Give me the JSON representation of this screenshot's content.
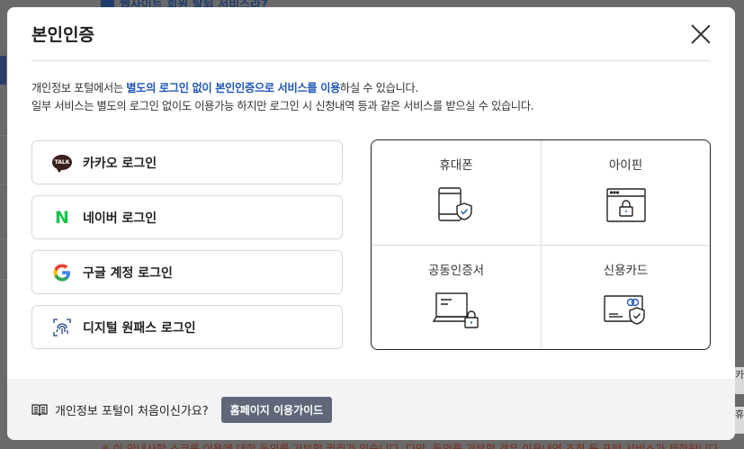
{
  "background": {
    "top_link": "웹사이트 회원 탈퇴 서비스라?",
    "bottom_notice": "※ 이 안내사항 스크롤 이용에 대한 동의를 거부할 권리가 있습니다. 다만, 동의를 거부할 경우 이용내역 조회 등 포털 서비스가 제한됩니다.",
    "right_chip_1": "카",
    "right_chip_2": "휴"
  },
  "modal": {
    "title": "본인인증",
    "intro": {
      "line1_prefix": "개인정보 포털에서는 ",
      "line1_emphasis": "별도의 로그인 없이 본인인증으로 서비스를 이용",
      "line1_suffix": "하실 수 있습니다.",
      "line2": "일부 서비스는 별도의 로그인 없이도 이용가능 하지만 로그인 시 신청내역 등과 같은 서비스를 받으실 수 있습니다."
    },
    "logins": [
      {
        "label": "카카오 로그인",
        "icon": "kakao-talk-icon",
        "icon_text": "TALK"
      },
      {
        "label": "네이버 로그인",
        "icon": "naver-icon",
        "icon_text": "N"
      },
      {
        "label": "구글 계정 로그인",
        "icon": "google-icon",
        "icon_text": "G"
      },
      {
        "label": "디지털 원패스 로그인",
        "icon": "fingerprint-icon"
      }
    ],
    "certificates": [
      {
        "label": "휴대폰",
        "icon": "mobile-phone-shield-icon"
      },
      {
        "label": "아이핀",
        "icon": "ipin-browser-lock-icon"
      },
      {
        "label": "공동인증서",
        "icon": "certificate-laptop-lock-icon"
      },
      {
        "label": "신용카드",
        "icon": "credit-card-shield-icon"
      }
    ],
    "footer": {
      "question": "개인정보 포털이 처음이신가요?",
      "guide_button": "홈페이지 이용가이드",
      "icon": "book-icon"
    }
  },
  "colors": {
    "emphasis": "#1f57b5",
    "naver_green": "#19c34a",
    "kakao_brown": "#3b1e1e",
    "guide_button_bg": "#5f6778",
    "overlay": "#6a6a6a"
  }
}
